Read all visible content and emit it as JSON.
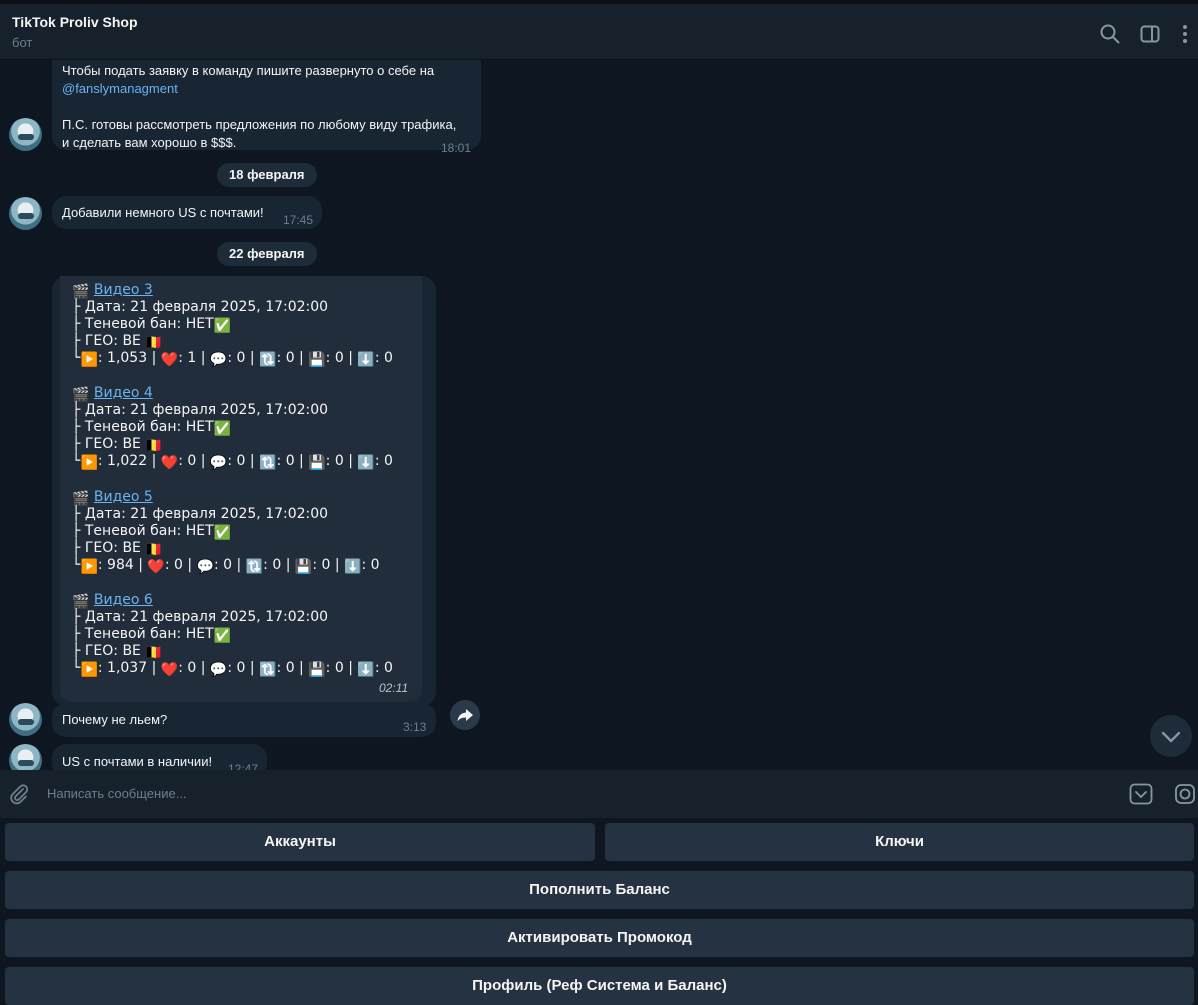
{
  "header": {
    "title": "TikTok Proliv Shop",
    "subtitle": "бот",
    "icons": [
      "search-icon",
      "sidebar-toggle-icon",
      "more-vertical-icon"
    ]
  },
  "messages": {
    "m1": {
      "line1": "Чтобы подать заявку в команду пишите развернуто о себе на",
      "link": "@fanslymanagment",
      "line3": "П.С. готовы рассмотреть предложения по любому виду трафика,",
      "line4": "и сделать вам хорошо в $$$.",
      "time": "18:01"
    },
    "date1": "18 февраля",
    "m2": {
      "text": "Добавили немного US с почтами!",
      "time": "17:45"
    },
    "date2": "22 февраля",
    "videos": [
      {
        "title": "Видео 3",
        "date": "├ Дата: 21 февраля 2025, 17:02:00",
        "shadow": "├ Теневой бан: НЕТ",
        "geo": "├ ГЕО: BE",
        "views": "1,053",
        "likes": "1",
        "comments": "0",
        "shares": "0",
        "saves": "0",
        "downloads": "0"
      },
      {
        "title": "Видео 4",
        "date": "├ Дата: 21 февраля 2025, 17:02:00",
        "shadow": "├ Теневой бан: НЕТ",
        "geo": "├ ГЕО: BE",
        "views": "1,022",
        "likes": "0",
        "comments": "0",
        "shares": "0",
        "saves": "0",
        "downloads": "0"
      },
      {
        "title": "Видео 5",
        "date": "├ Дата: 21 февраля 2025, 17:02:00",
        "shadow": "├ Теневой бан: НЕТ",
        "geo": "├ ГЕО: BE",
        "views": "984",
        "likes": "0",
        "comments": "0",
        "shares": "0",
        "saves": "0",
        "downloads": "0"
      },
      {
        "title": "Видео 6",
        "date": "├ Дата: 21 февраля 2025, 17:02:00",
        "shadow": "├ Теневой бан: НЕТ",
        "geo": "├ ГЕО: BE",
        "views": "1,037",
        "likes": "0",
        "comments": "0",
        "shares": "0",
        "saves": "0",
        "downloads": "0"
      }
    ],
    "videos_time": "02:11",
    "m3": {
      "text": "Почему не льем?",
      "time": "3:13"
    },
    "m4": {
      "text": "US с почтами в наличии!",
      "time": "12:47"
    }
  },
  "composer": {
    "placeholder": "Написать сообщение..."
  },
  "keyboard": {
    "accounts": "Аккаунты",
    "keys": "Ключи",
    "topup": "Пополнить Баланс",
    "promo": "Активировать Промокод",
    "profile": "Профиль (Реф Система и Баланс)"
  },
  "colors": {
    "background": "#0e1621",
    "bubble": "#182533",
    "accent": "#6ab3f3",
    "button": "#253241"
  }
}
